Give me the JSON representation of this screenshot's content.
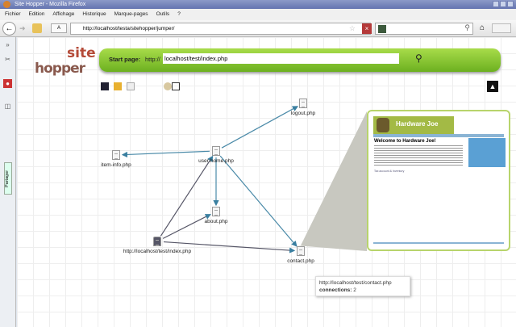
{
  "window": {
    "title": "Site Hopper - Mozilla Firefox"
  },
  "menu": [
    "Fichier",
    "Edition",
    "Affichage",
    "Historique",
    "Marque-pages",
    "Outils",
    "?"
  ],
  "navbar": {
    "url": "http://localhost/testa/sitehopper/jumper/",
    "zoom_label": "A"
  },
  "sidebar": {
    "share_label": "Partager"
  },
  "app": {
    "logo_site": "site",
    "logo_hopper": "hopper",
    "start_label": "Start page:",
    "start_prefix": "http://",
    "start_value": "localhost/test/index.php"
  },
  "nodes": [
    {
      "id": "logout",
      "label": "logout.php"
    },
    {
      "id": "iteminfo",
      "label": "item-info.php"
    },
    {
      "id": "userhome",
      "label": "user-home.php"
    },
    {
      "id": "about",
      "label": "about.php"
    },
    {
      "id": "index",
      "label": "http://localhost/test/index.php"
    },
    {
      "id": "contact",
      "label": "contact.php"
    }
  ],
  "edges": [
    [
      "userhome",
      "logout"
    ],
    [
      "userhome",
      "iteminfo"
    ],
    [
      "userhome",
      "about"
    ],
    [
      "index",
      "userhome"
    ],
    [
      "index",
      "about"
    ],
    [
      "index",
      "contact"
    ],
    [
      "userhome",
      "contact"
    ]
  ],
  "preview": {
    "brand": "Hardware Joe",
    "heading": "Welcome to Hardware Joe!",
    "link": "Tax account & Inventory"
  },
  "tooltip": {
    "url": "http://localhost/test/contact.php",
    "connections_label": "connections:",
    "connections": "2"
  },
  "colors": {
    "accent": "#7cc02a",
    "edge": "#4a8aa8"
  }
}
